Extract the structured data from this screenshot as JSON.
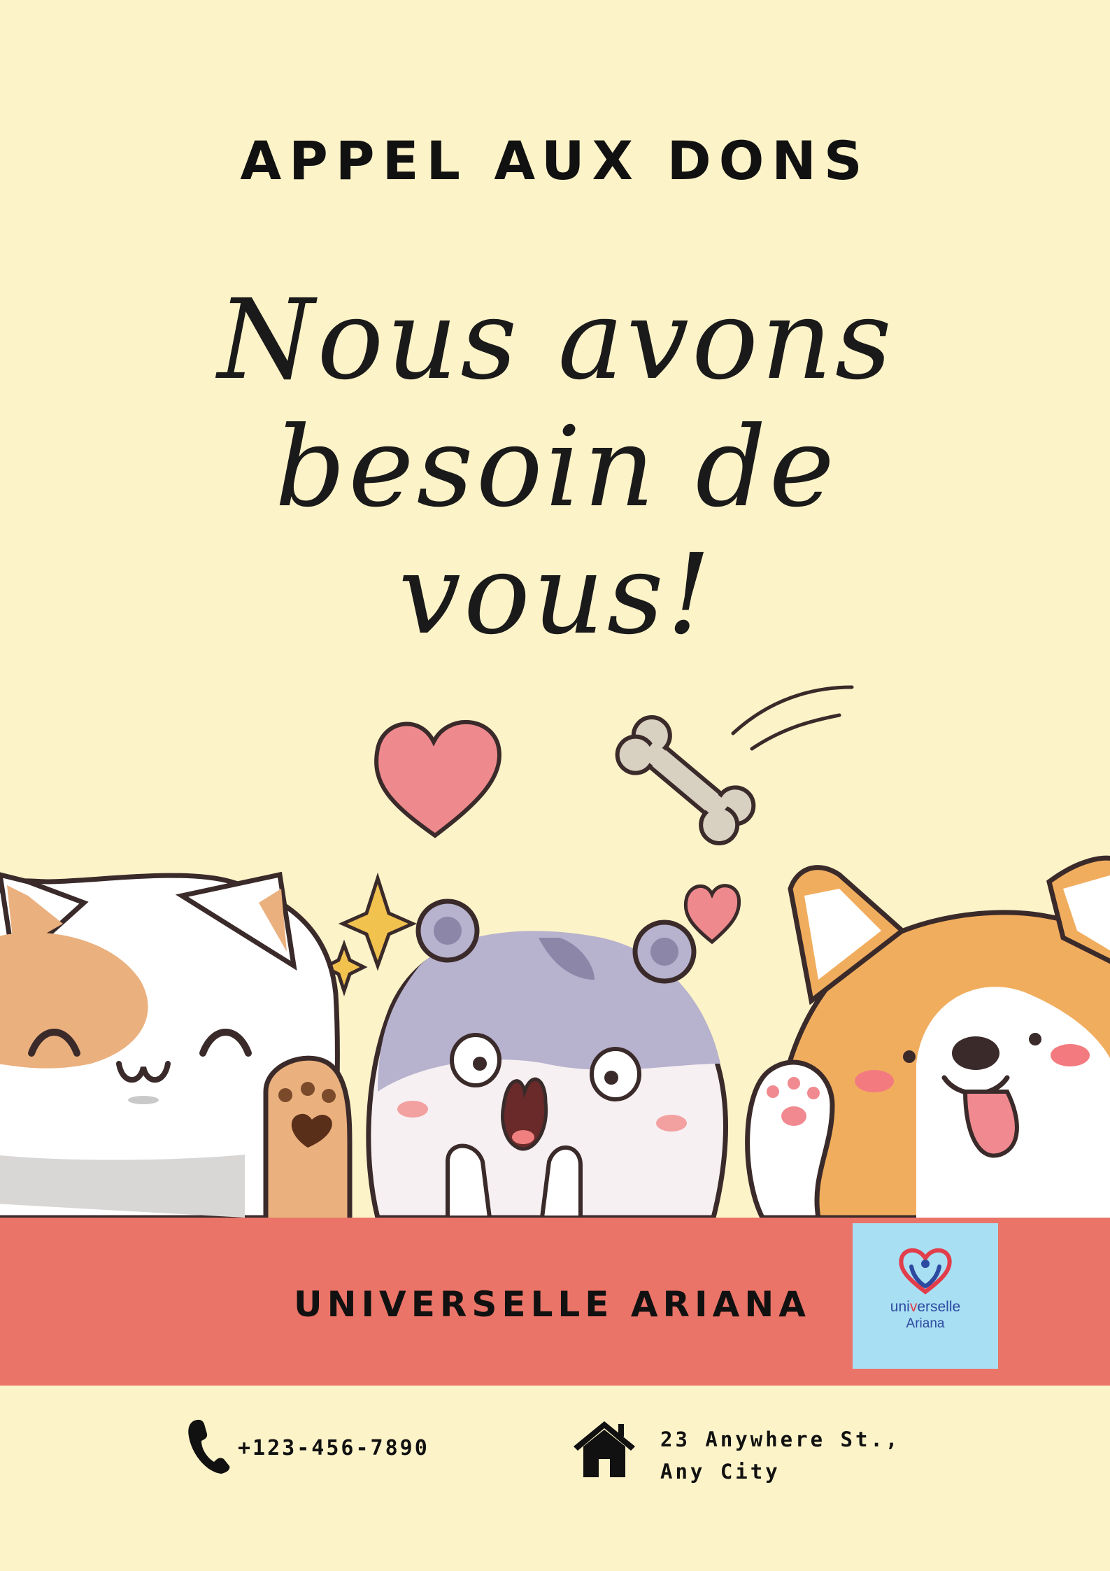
{
  "header": {
    "title": "APPEL AUX DONS"
  },
  "headline": {
    "line1": "Nous avons",
    "line2": "besoin de",
    "line3": "vous!"
  },
  "illustration": {
    "icons": [
      "heart-icon",
      "bone-icon",
      "sparkle-icon",
      "cat-icon",
      "hamster-icon",
      "dog-icon"
    ]
  },
  "banner": {
    "organization": "UNIVERSELLE ARIANA",
    "logo": {
      "line1_part1": "uni",
      "line1_heart": "v",
      "line1_part2": "erselle",
      "line2": "Ariana"
    }
  },
  "contact": {
    "phone": "+123-456-7890",
    "address_line1": "23 Anywhere St.,",
    "address_line2": "Any City"
  },
  "colors": {
    "background": "#fdf3c8",
    "banner": "#ea7467",
    "logo_bg": "#a9dff3",
    "text": "#111111"
  }
}
